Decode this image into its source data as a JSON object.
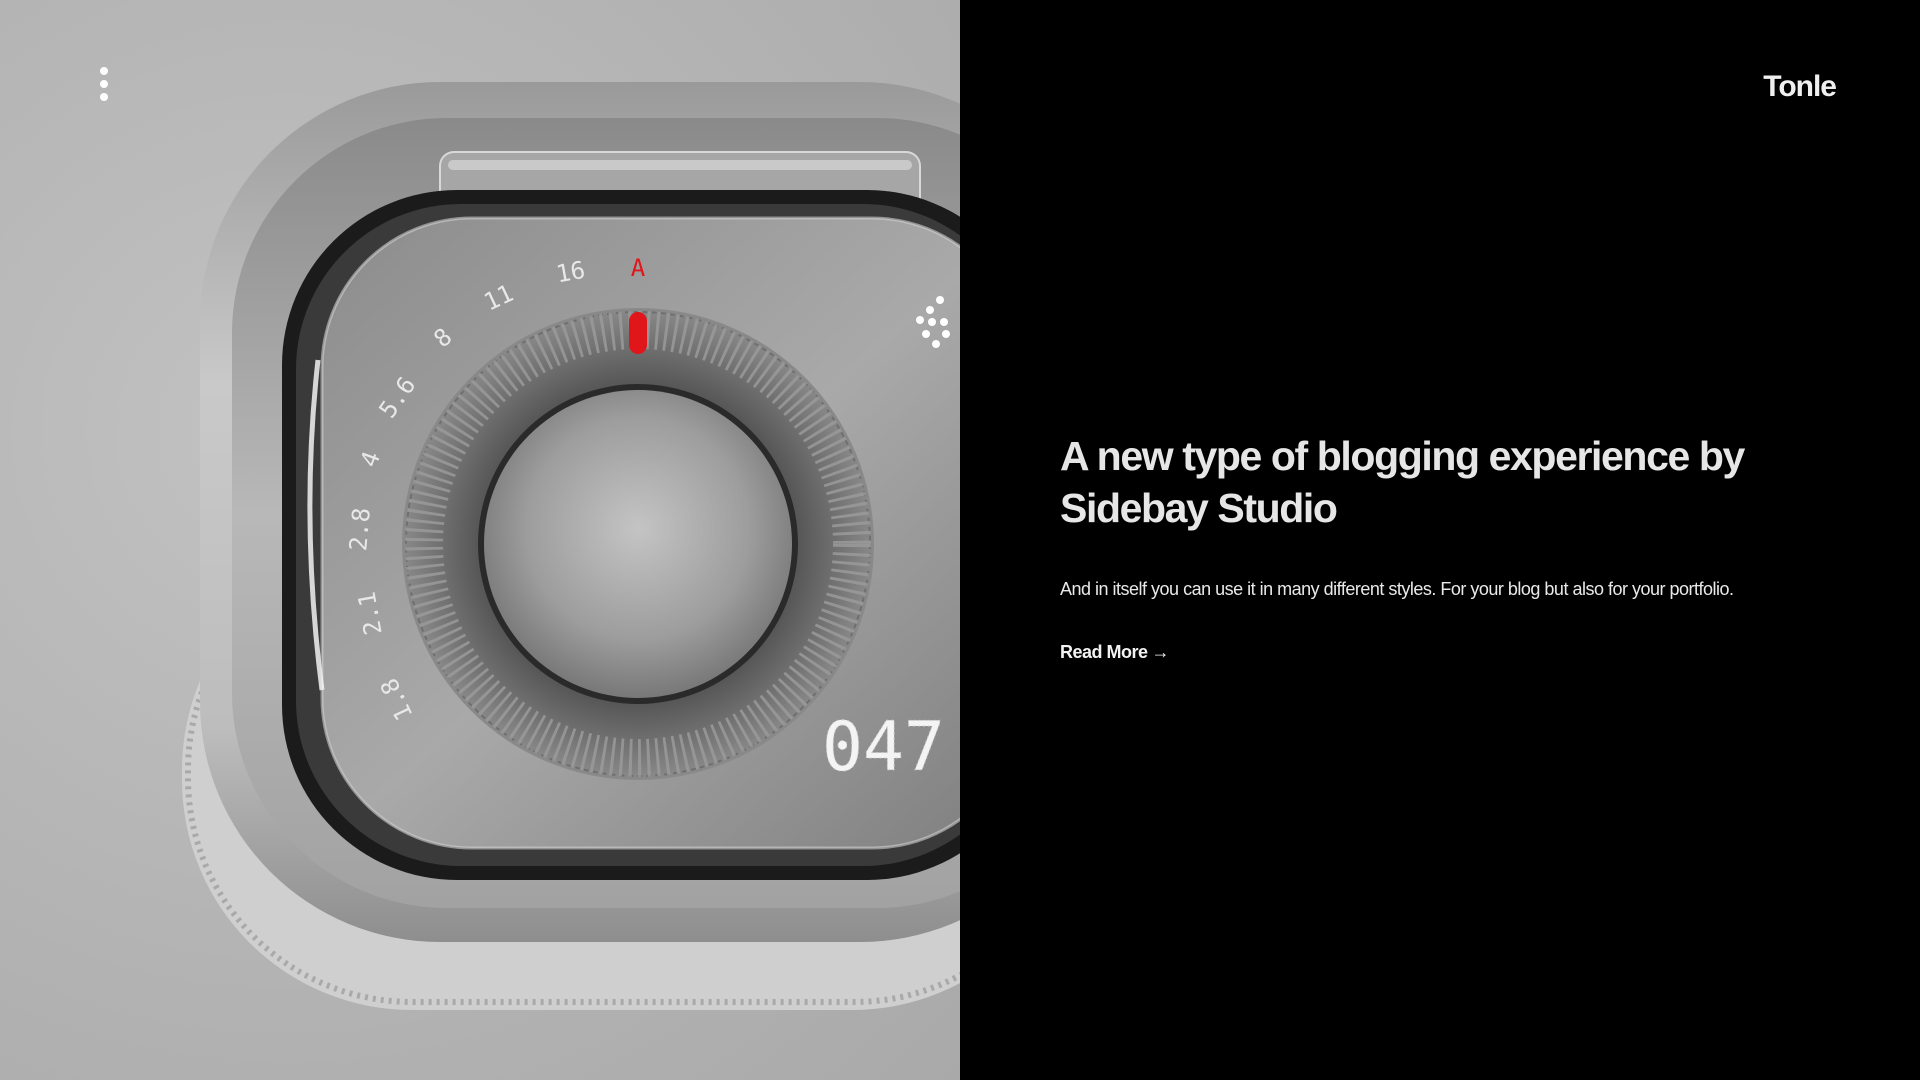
{
  "nav": {
    "menu_icon": "vertical-dots-icon",
    "brand": "Tonle"
  },
  "hero": {
    "aperture_scale": [
      "1.8",
      "2.1",
      "2.8",
      "4",
      "5.6",
      "8",
      "11",
      "16",
      "A"
    ],
    "display_readout": "047",
    "accent_color": "#e0161b",
    "display_icon": "flash-icon"
  },
  "post": {
    "headline": "A new type of blogging experience by Sidebay Studio",
    "description": "And in itself you can use it in many different styles. For your blog but also for your portfolio.",
    "read_more": "Read More",
    "read_more_icon": "arrow-right-icon"
  },
  "colors": {
    "panel_background": "#000000",
    "hero_background": "#b4b4b4",
    "text": "#ffffff"
  }
}
